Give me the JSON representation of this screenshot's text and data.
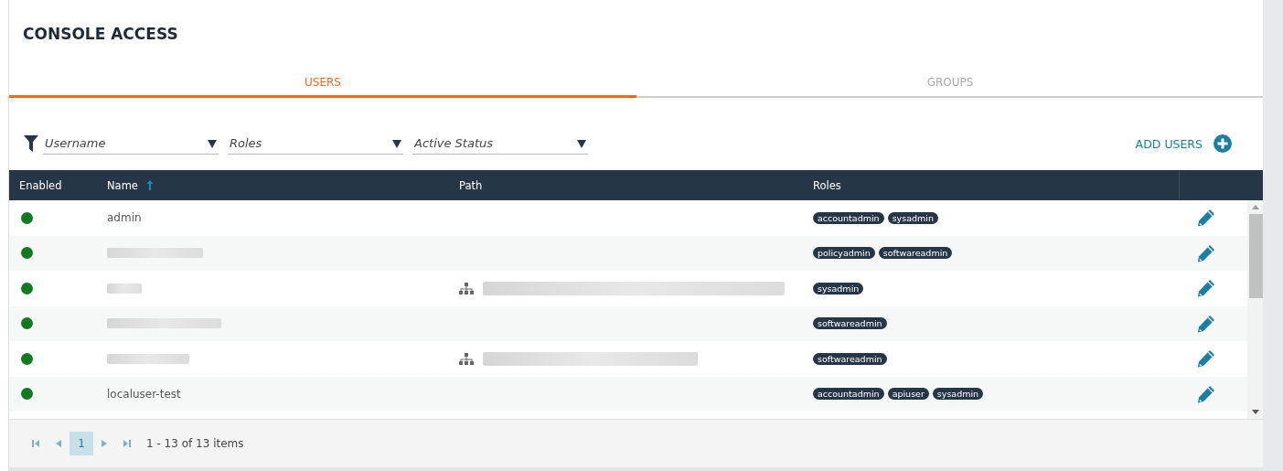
{
  "title": "CONSOLE ACCESS",
  "tabs": [
    {
      "label": "USERS",
      "selected": true
    },
    {
      "label": "GROUPS",
      "selected": false
    }
  ],
  "filters": [
    {
      "placeholder": "Username"
    },
    {
      "placeholder": "Roles"
    },
    {
      "placeholder": "Active Status"
    }
  ],
  "add_button": "ADD USERS",
  "table": {
    "columns": [
      {
        "label": "Enabled",
        "sorted": false
      },
      {
        "label": "Name",
        "sorted": true
      },
      {
        "label": "Path",
        "sorted": false
      },
      {
        "label": "Roles",
        "sorted": false
      }
    ],
    "rows": [
      {
        "enabled": true,
        "name": "admin",
        "name_hidden": false,
        "roles": [
          "accountadmin",
          "sysadmin"
        ]
      },
      {
        "enabled": true,
        "name_hidden": true,
        "roles": [
          "policyadmin",
          "softwareadmin"
        ]
      },
      {
        "enabled": true,
        "name_hidden": true,
        "path_hidden": true,
        "roles": [
          "sysadmin"
        ]
      },
      {
        "enabled": true,
        "name_hidden": true,
        "roles": [
          "softwareadmin"
        ]
      },
      {
        "enabled": true,
        "name_hidden": true,
        "path_hidden": true,
        "roles": [
          "softwareadmin"
        ]
      },
      {
        "enabled": true,
        "name": "localuser-test",
        "name_hidden": false,
        "roles": [
          "accountadmin",
          "apiuser",
          "sysadmin"
        ]
      }
    ]
  },
  "pager": {
    "pages": [
      {
        "label": "1",
        "selected": true
      }
    ],
    "summary": "1 - 13 of 13 items"
  }
}
